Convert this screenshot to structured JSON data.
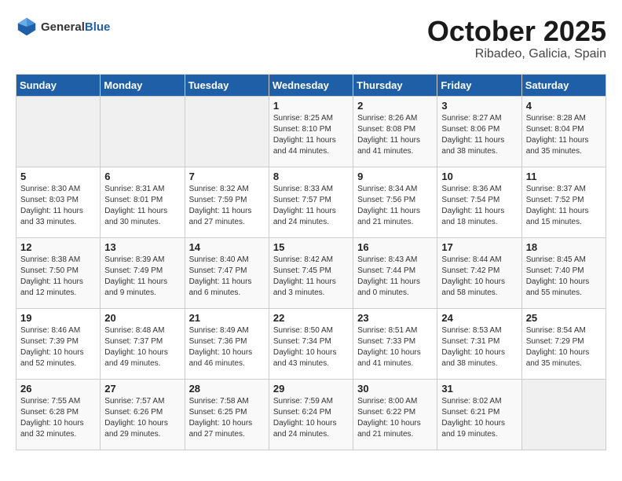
{
  "logo": {
    "line1": "General",
    "line2": "Blue"
  },
  "title": "October 2025",
  "subtitle": "Ribadeo, Galicia, Spain",
  "days_of_week": [
    "Sunday",
    "Monday",
    "Tuesday",
    "Wednesday",
    "Thursday",
    "Friday",
    "Saturday"
  ],
  "weeks": [
    [
      {
        "day": "",
        "info": ""
      },
      {
        "day": "",
        "info": ""
      },
      {
        "day": "",
        "info": ""
      },
      {
        "day": "1",
        "info": "Sunrise: 8:25 AM\nSunset: 8:10 PM\nDaylight: 11 hours\nand 44 minutes."
      },
      {
        "day": "2",
        "info": "Sunrise: 8:26 AM\nSunset: 8:08 PM\nDaylight: 11 hours\nand 41 minutes."
      },
      {
        "day": "3",
        "info": "Sunrise: 8:27 AM\nSunset: 8:06 PM\nDaylight: 11 hours\nand 38 minutes."
      },
      {
        "day": "4",
        "info": "Sunrise: 8:28 AM\nSunset: 8:04 PM\nDaylight: 11 hours\nand 35 minutes."
      }
    ],
    [
      {
        "day": "5",
        "info": "Sunrise: 8:30 AM\nSunset: 8:03 PM\nDaylight: 11 hours\nand 33 minutes."
      },
      {
        "day": "6",
        "info": "Sunrise: 8:31 AM\nSunset: 8:01 PM\nDaylight: 11 hours\nand 30 minutes."
      },
      {
        "day": "7",
        "info": "Sunrise: 8:32 AM\nSunset: 7:59 PM\nDaylight: 11 hours\nand 27 minutes."
      },
      {
        "day": "8",
        "info": "Sunrise: 8:33 AM\nSunset: 7:57 PM\nDaylight: 11 hours\nand 24 minutes."
      },
      {
        "day": "9",
        "info": "Sunrise: 8:34 AM\nSunset: 7:56 PM\nDaylight: 11 hours\nand 21 minutes."
      },
      {
        "day": "10",
        "info": "Sunrise: 8:36 AM\nSunset: 7:54 PM\nDaylight: 11 hours\nand 18 minutes."
      },
      {
        "day": "11",
        "info": "Sunrise: 8:37 AM\nSunset: 7:52 PM\nDaylight: 11 hours\nand 15 minutes."
      }
    ],
    [
      {
        "day": "12",
        "info": "Sunrise: 8:38 AM\nSunset: 7:50 PM\nDaylight: 11 hours\nand 12 minutes."
      },
      {
        "day": "13",
        "info": "Sunrise: 8:39 AM\nSunset: 7:49 PM\nDaylight: 11 hours\nand 9 minutes."
      },
      {
        "day": "14",
        "info": "Sunrise: 8:40 AM\nSunset: 7:47 PM\nDaylight: 11 hours\nand 6 minutes."
      },
      {
        "day": "15",
        "info": "Sunrise: 8:42 AM\nSunset: 7:45 PM\nDaylight: 11 hours\nand 3 minutes."
      },
      {
        "day": "16",
        "info": "Sunrise: 8:43 AM\nSunset: 7:44 PM\nDaylight: 11 hours\nand 0 minutes."
      },
      {
        "day": "17",
        "info": "Sunrise: 8:44 AM\nSunset: 7:42 PM\nDaylight: 10 hours\nand 58 minutes."
      },
      {
        "day": "18",
        "info": "Sunrise: 8:45 AM\nSunset: 7:40 PM\nDaylight: 10 hours\nand 55 minutes."
      }
    ],
    [
      {
        "day": "19",
        "info": "Sunrise: 8:46 AM\nSunset: 7:39 PM\nDaylight: 10 hours\nand 52 minutes."
      },
      {
        "day": "20",
        "info": "Sunrise: 8:48 AM\nSunset: 7:37 PM\nDaylight: 10 hours\nand 49 minutes."
      },
      {
        "day": "21",
        "info": "Sunrise: 8:49 AM\nSunset: 7:36 PM\nDaylight: 10 hours\nand 46 minutes."
      },
      {
        "day": "22",
        "info": "Sunrise: 8:50 AM\nSunset: 7:34 PM\nDaylight: 10 hours\nand 43 minutes."
      },
      {
        "day": "23",
        "info": "Sunrise: 8:51 AM\nSunset: 7:33 PM\nDaylight: 10 hours\nand 41 minutes."
      },
      {
        "day": "24",
        "info": "Sunrise: 8:53 AM\nSunset: 7:31 PM\nDaylight: 10 hours\nand 38 minutes."
      },
      {
        "day": "25",
        "info": "Sunrise: 8:54 AM\nSunset: 7:29 PM\nDaylight: 10 hours\nand 35 minutes."
      }
    ],
    [
      {
        "day": "26",
        "info": "Sunrise: 7:55 AM\nSunset: 6:28 PM\nDaylight: 10 hours\nand 32 minutes."
      },
      {
        "day": "27",
        "info": "Sunrise: 7:57 AM\nSunset: 6:26 PM\nDaylight: 10 hours\nand 29 minutes."
      },
      {
        "day": "28",
        "info": "Sunrise: 7:58 AM\nSunset: 6:25 PM\nDaylight: 10 hours\nand 27 minutes."
      },
      {
        "day": "29",
        "info": "Sunrise: 7:59 AM\nSunset: 6:24 PM\nDaylight: 10 hours\nand 24 minutes."
      },
      {
        "day": "30",
        "info": "Sunrise: 8:00 AM\nSunset: 6:22 PM\nDaylight: 10 hours\nand 21 minutes."
      },
      {
        "day": "31",
        "info": "Sunrise: 8:02 AM\nSunset: 6:21 PM\nDaylight: 10 hours\nand 19 minutes."
      },
      {
        "day": "",
        "info": ""
      }
    ]
  ]
}
